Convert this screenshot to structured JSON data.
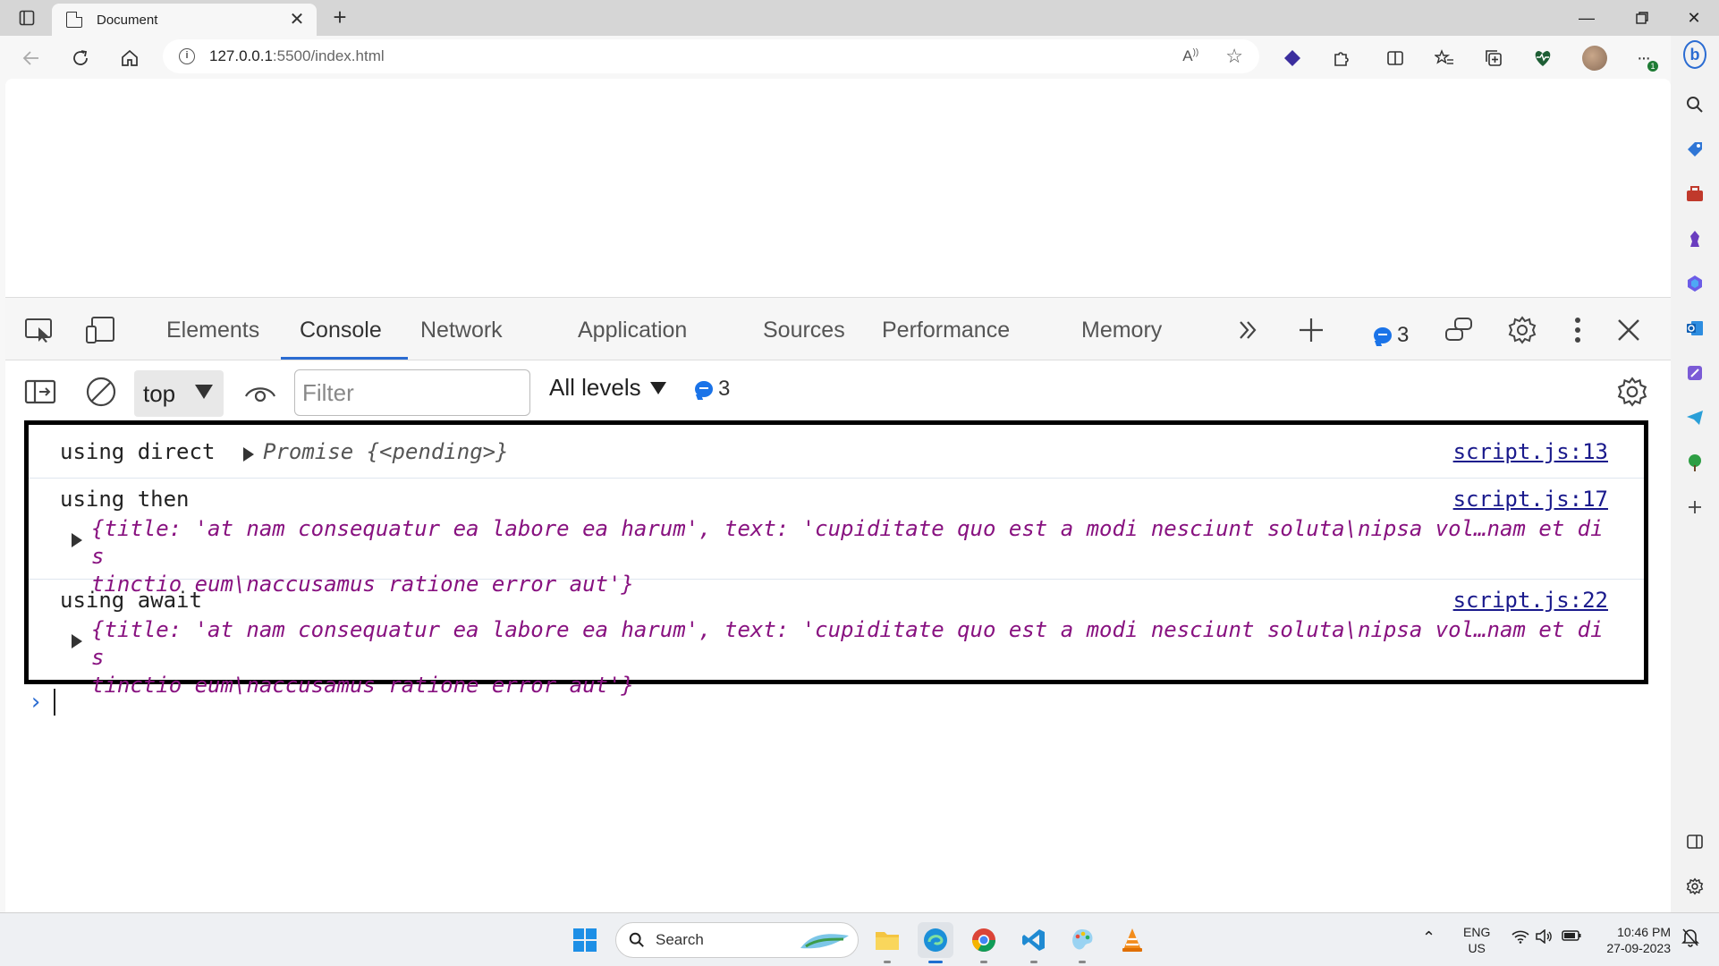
{
  "browser": {
    "tab_title": "Document",
    "url_host": "127.0.0.1",
    "url_rest": ":5500/index.html"
  },
  "devtools": {
    "tabs": [
      "Elements",
      "Console",
      "Network",
      "Application",
      "Sources",
      "Performance",
      "Memory"
    ],
    "active_tab": "Console",
    "issues_count": "3",
    "toolbar": {
      "context": "top",
      "filter_placeholder": "Filter",
      "levels": "All levels",
      "messages_count": "3"
    }
  },
  "console": {
    "entries": [
      {
        "message": "using direct",
        "promise": "Promise {<pending>}",
        "source": "script.js:13"
      },
      {
        "message": "using then",
        "object_line1": "{title: 'at nam consequatur ea labore ea harum', text: 'cupiditate quo est a modi nesciunt soluta\\nipsa vol…nam et dis",
        "object_line2": "tinctio eum\\naccusamus ratione error aut'}",
        "source": "script.js:17"
      },
      {
        "message": "using await",
        "object_line1": "{title: 'at nam consequatur ea labore ea harum', text: 'cupiditate quo est a modi nesciunt soluta\\nipsa vol…nam et dis",
        "object_line2": "tinctio eum\\naccusamus ratione error aut'}",
        "source": "script.js:22"
      }
    ]
  },
  "taskbar": {
    "search_label": "Search",
    "lang_line1": "ENG",
    "lang_line2": "US",
    "time": "10:46 PM",
    "date": "27-09-2023"
  }
}
